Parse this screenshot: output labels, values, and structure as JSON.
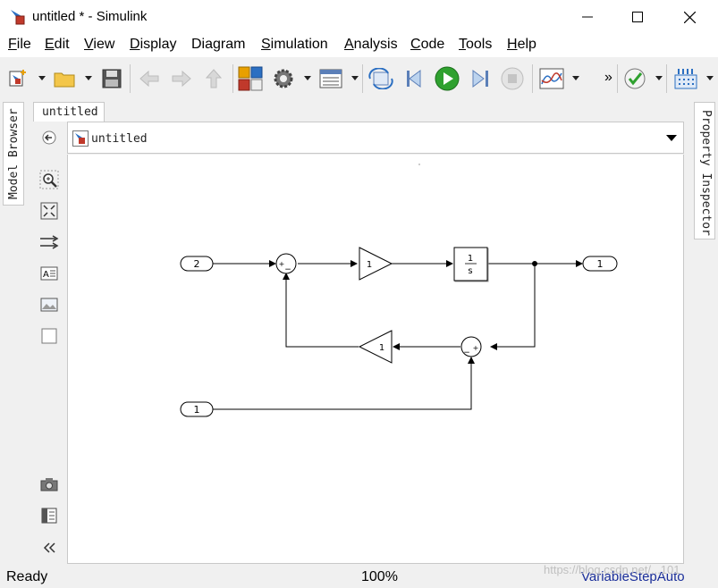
{
  "window": {
    "title": "untitled * - Simulink"
  },
  "menu": [
    {
      "label": "File",
      "key": "F"
    },
    {
      "label": "Edit",
      "key": "E"
    },
    {
      "label": "View",
      "key": "V"
    },
    {
      "label": "Display",
      "key": "D"
    },
    {
      "label": "Diagram",
      "key": "g"
    },
    {
      "label": "Simulation",
      "key": "S"
    },
    {
      "label": "Analysis",
      "key": "A"
    },
    {
      "label": "Code",
      "key": "C"
    },
    {
      "label": "Tools",
      "key": "T"
    },
    {
      "label": "Help",
      "key": "H"
    }
  ],
  "toolbar": {
    "overflow_label": "»",
    "icons": [
      "new-model-icon",
      "open-folder-icon",
      "save-icon",
      "back-arrow-icon",
      "forward-arrow-icon",
      "up-arrow-icon",
      "library-browser-icon",
      "settings-gear-icon",
      "model-explorer-icon",
      "update-diagram-icon",
      "step-back-icon",
      "run-icon",
      "step-forward-icon",
      "stop-icon",
      "scope-icon",
      "model-advisor-icon",
      "build-icon"
    ]
  },
  "side_tabs": {
    "left": "Model Browser",
    "right": "Property Inspector"
  },
  "doc_tab": "untitled",
  "address": "untitled",
  "diagram": {
    "inports": [
      {
        "number": "2"
      },
      {
        "number": "1"
      }
    ],
    "outports": [
      {
        "number": "1"
      }
    ],
    "gains": [
      {
        "value": "1",
        "direction": "right"
      },
      {
        "value": "1",
        "direction": "left"
      }
    ],
    "integrator": {
      "numerator": "1",
      "denominator": "s"
    },
    "sums": [
      {
        "signs": [
          "+",
          "−"
        ]
      },
      {
        "signs": [
          "−",
          "+"
        ]
      }
    ]
  },
  "status": {
    "state": "Ready",
    "zoom": "100%",
    "solver": "VariableStepAuto"
  },
  "watermark": "https://blog.csdn.net/...101",
  "colors": {
    "run_green": "#2fa12f",
    "solver_text": "#1a2e9a",
    "background": "#f0f0f0"
  }
}
